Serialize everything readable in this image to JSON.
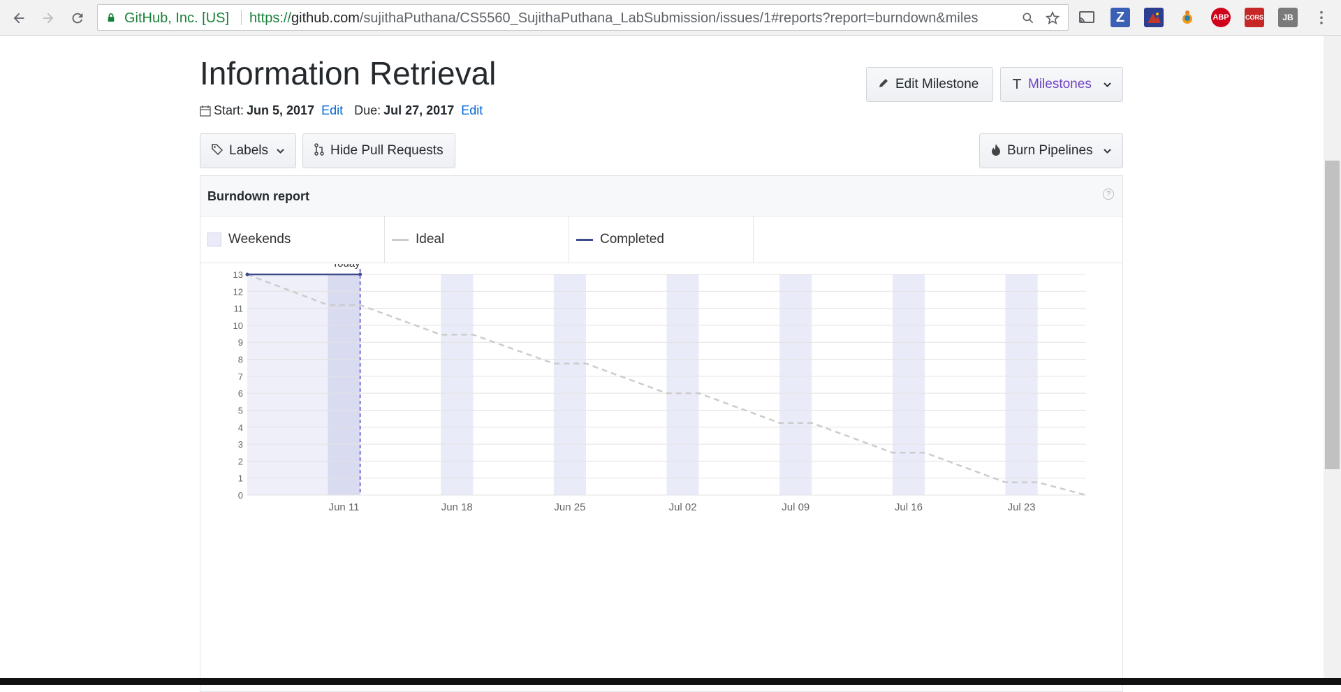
{
  "browser": {
    "org": "GitHub, Inc. [US]",
    "url_scheme": "https://",
    "url_domain": "github.com",
    "url_path": "/sujithaPuthana/CS5560_SujithaPuthana_LabSubmission/issues/1#reports?report=burndown&miles",
    "extensions": [
      "cast-icon",
      "z-extension-icon",
      "screen-capture-icon",
      "firebug-icon",
      "abp-icon",
      "cors-icon",
      "jb-icon"
    ],
    "ext_labels": {
      "abp": "ABP",
      "cors": "CORS",
      "jb": "JB",
      "z": "Z"
    }
  },
  "milestone": {
    "title": "Information Retrieval",
    "start_label": "Start:",
    "start_date": "Jun 5, 2017",
    "due_label": "Due:",
    "due_date": "Jul 27, 2017",
    "edit_label": "Edit"
  },
  "buttons": {
    "edit_milestone": "Edit Milestone",
    "milestones": "Milestones",
    "labels": "Labels",
    "hide_prs": "Hide Pull Requests",
    "burn_pipelines": "Burn Pipelines"
  },
  "report": {
    "title": "Burndown report",
    "help": "?",
    "legend": {
      "weekends": "Weekends",
      "ideal": "Ideal",
      "completed": "Completed"
    }
  },
  "colors": {
    "weekend": "#eaebf8",
    "ideal": "#cccccc",
    "completed": "#3f4a8a",
    "today": "#7b72d8",
    "link": "#0366d6",
    "milestones_text": "#6f42c1"
  },
  "chart_data": {
    "type": "line",
    "x_start": "2017-06-05",
    "x_end": "2017-07-27",
    "xticks": [
      "Jun 11",
      "Jun 18",
      "Jun 25",
      "Jul 02",
      "Jul 09",
      "Jul 16",
      "Jul 23"
    ],
    "ylim": [
      0,
      13
    ],
    "yticks": [
      0,
      1,
      2,
      3,
      4,
      5,
      6,
      7,
      8,
      9,
      10,
      11,
      12,
      13
    ],
    "today_label": "Today",
    "today_date": "2017-06-12",
    "weekends": [
      [
        "2017-06-10",
        "2017-06-12"
      ],
      [
        "2017-06-17",
        "2017-06-19"
      ],
      [
        "2017-06-24",
        "2017-06-26"
      ],
      [
        "2017-07-01",
        "2017-07-03"
      ],
      [
        "2017-07-08",
        "2017-07-10"
      ],
      [
        "2017-07-15",
        "2017-07-17"
      ],
      [
        "2017-07-22",
        "2017-07-24"
      ]
    ],
    "elapsed_range": [
      "2017-06-05",
      "2017-06-12"
    ],
    "series": [
      {
        "name": "Ideal",
        "points": [
          [
            "2017-06-05",
            13
          ],
          [
            "2017-06-10",
            11.2
          ],
          [
            "2017-06-12",
            11.2
          ],
          [
            "2017-06-17",
            9.45
          ],
          [
            "2017-06-19",
            9.45
          ],
          [
            "2017-06-24",
            7.75
          ],
          [
            "2017-06-26",
            7.75
          ],
          [
            "2017-07-01",
            6.0
          ],
          [
            "2017-07-03",
            6.0
          ],
          [
            "2017-07-08",
            4.25
          ],
          [
            "2017-07-10",
            4.25
          ],
          [
            "2017-07-15",
            2.5
          ],
          [
            "2017-07-17",
            2.5
          ],
          [
            "2017-07-22",
            0.75
          ],
          [
            "2017-07-24",
            0.75
          ],
          [
            "2017-07-27",
            0
          ]
        ]
      },
      {
        "name": "Completed",
        "points": [
          [
            "2017-06-05",
            13
          ],
          [
            "2017-06-12",
            13
          ]
        ]
      }
    ]
  }
}
